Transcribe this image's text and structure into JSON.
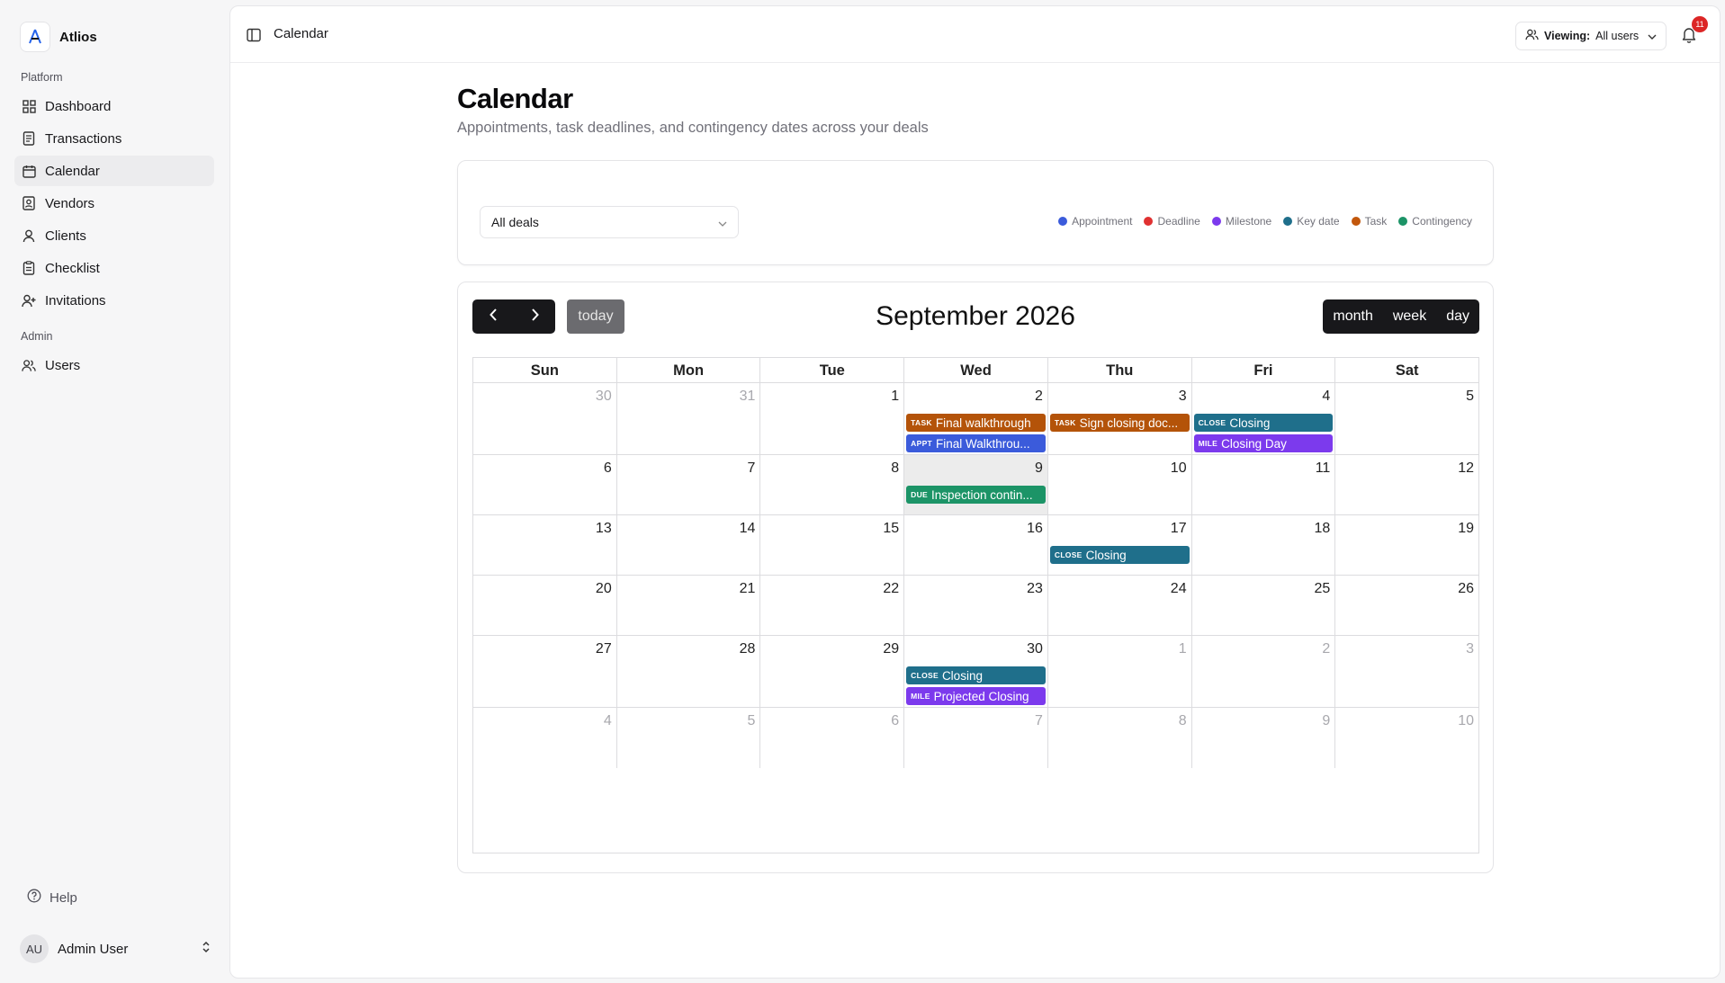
{
  "brand": {
    "name": "Atlios"
  },
  "sidebar": {
    "platform_label": "Platform",
    "items": [
      {
        "label": "Dashboard",
        "icon": "dashboard-icon"
      },
      {
        "label": "Transactions",
        "icon": "receipt-icon"
      },
      {
        "label": "Calendar",
        "icon": "calendar-icon"
      },
      {
        "label": "Vendors",
        "icon": "contact-card-icon"
      },
      {
        "label": "Clients",
        "icon": "user-icon"
      },
      {
        "label": "Checklist",
        "icon": "clipboard-icon"
      },
      {
        "label": "Invitations",
        "icon": "user-plus-icon"
      }
    ],
    "admin_label": "Admin",
    "admin_items": [
      {
        "label": "Users",
        "icon": "users-icon"
      }
    ],
    "help_label": "Help",
    "user": {
      "initials": "AU",
      "name": "Admin User"
    }
  },
  "topbar": {
    "breadcrumb": "Calendar",
    "viewing_label": "Viewing:",
    "viewing_value": "All users",
    "notification_count": "11"
  },
  "page": {
    "title": "Calendar",
    "subtitle": "Appointments, task deadlines, and contingency dates across your deals"
  },
  "filter": {
    "deal_select": "All deals",
    "legend": [
      {
        "label": "Appointment",
        "color": "#3b5bdb"
      },
      {
        "label": "Deadline",
        "color": "#e03131"
      },
      {
        "label": "Milestone",
        "color": "#7c3aed"
      },
      {
        "label": "Key date",
        "color": "#1f6f8b"
      },
      {
        "label": "Task",
        "color": "#c2570c"
      },
      {
        "label": "Contingency",
        "color": "#1c9467"
      }
    ]
  },
  "calendar": {
    "title": "September 2026",
    "today_label": "today",
    "views": [
      "month",
      "week",
      "day"
    ],
    "weekdays": [
      "Sun",
      "Mon",
      "Tue",
      "Wed",
      "Thu",
      "Fri",
      "Sat"
    ],
    "weeks": [
      [
        {
          "n": "30",
          "other": true,
          "events": []
        },
        {
          "n": "31",
          "other": true,
          "events": []
        },
        {
          "n": "1",
          "events": []
        },
        {
          "n": "2",
          "events": [
            {
              "tag": "TASK",
              "title": "Final walkthrough",
              "color": "#b45309"
            },
            {
              "tag": "APPT",
              "title": "Final Walkthrou...",
              "color": "#3b5bdb"
            }
          ]
        },
        {
          "n": "3",
          "events": [
            {
              "tag": "TASK",
              "title": "Sign closing doc...",
              "color": "#b45309"
            }
          ]
        },
        {
          "n": "4",
          "events": [
            {
              "tag": "CLOSE",
              "title": "Closing",
              "color": "#1f6f8b"
            },
            {
              "tag": "MILE",
              "title": "Closing Day",
              "color": "#7c3aed"
            }
          ]
        },
        {
          "n": "5",
          "events": []
        }
      ],
      [
        {
          "n": "6",
          "events": []
        },
        {
          "n": "7",
          "events": []
        },
        {
          "n": "8",
          "events": []
        },
        {
          "n": "9",
          "today": true,
          "events": [
            {
              "tag": "DUE",
              "title": "Inspection contin...",
              "color": "#1c9467"
            }
          ]
        },
        {
          "n": "10",
          "events": []
        },
        {
          "n": "11",
          "events": []
        },
        {
          "n": "12",
          "events": []
        }
      ],
      [
        {
          "n": "13",
          "events": []
        },
        {
          "n": "14",
          "events": []
        },
        {
          "n": "15",
          "events": []
        },
        {
          "n": "16",
          "events": []
        },
        {
          "n": "17",
          "events": [
            {
              "tag": "CLOSE",
              "title": "Closing",
              "color": "#1f6f8b"
            }
          ]
        },
        {
          "n": "18",
          "events": []
        },
        {
          "n": "19",
          "events": []
        }
      ],
      [
        {
          "n": "20",
          "events": []
        },
        {
          "n": "21",
          "events": []
        },
        {
          "n": "22",
          "events": []
        },
        {
          "n": "23",
          "events": []
        },
        {
          "n": "24",
          "events": []
        },
        {
          "n": "25",
          "events": []
        },
        {
          "n": "26",
          "events": []
        }
      ],
      [
        {
          "n": "27",
          "events": []
        },
        {
          "n": "28",
          "events": []
        },
        {
          "n": "29",
          "events": []
        },
        {
          "n": "30",
          "events": [
            {
              "tag": "CLOSE",
              "title": "Closing",
              "color": "#1f6f8b"
            },
            {
              "tag": "MILE",
              "title": "Projected Closing",
              "color": "#7c3aed"
            }
          ]
        },
        {
          "n": "1",
          "other": true,
          "events": []
        },
        {
          "n": "2",
          "other": true,
          "events": []
        },
        {
          "n": "3",
          "other": true,
          "events": []
        }
      ],
      [
        {
          "n": "4",
          "other": true,
          "events": []
        },
        {
          "n": "5",
          "other": true,
          "events": []
        },
        {
          "n": "6",
          "other": true,
          "events": []
        },
        {
          "n": "7",
          "other": true,
          "events": []
        },
        {
          "n": "8",
          "other": true,
          "events": []
        },
        {
          "n": "9",
          "other": true,
          "events": []
        },
        {
          "n": "10",
          "other": true,
          "events": []
        }
      ]
    ]
  }
}
